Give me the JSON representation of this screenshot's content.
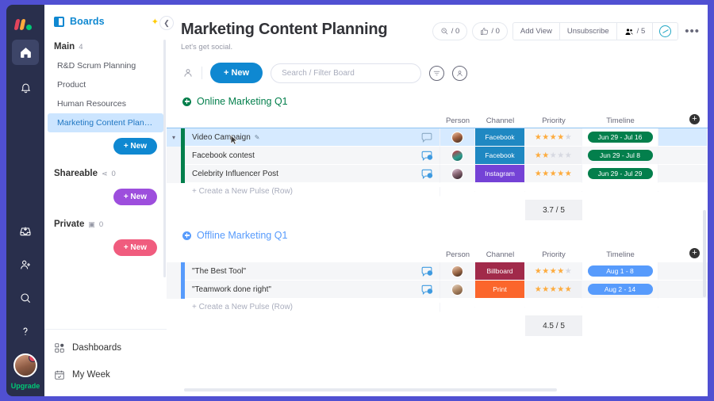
{
  "rail": {
    "logo": "monday-logo",
    "items": [
      {
        "name": "home-icon",
        "active": true
      },
      {
        "name": "notifications-bell-icon",
        "active": false
      }
    ],
    "bottom_items": [
      {
        "name": "inbox-icon"
      },
      {
        "name": "invite-member-icon"
      },
      {
        "name": "search-icon"
      },
      {
        "name": "help-icon"
      }
    ],
    "upgrade_label": "Upgrade"
  },
  "sidebar": {
    "title": "Boards",
    "favorite_icon": "star-icon",
    "collapse_icon": "chevron-left-icon",
    "sections": [
      {
        "label": "Main",
        "count": "4",
        "items": [
          {
            "label": "R&D Scrum Planning",
            "selected": false
          },
          {
            "label": "Product",
            "selected": false
          },
          {
            "label": "Human Resources",
            "selected": false
          },
          {
            "label": "Marketing Content Planning",
            "selected": true
          }
        ],
        "new_label": "+ New",
        "new_color": "#0f88d1"
      },
      {
        "label": "Shareable",
        "share_icon": "share-icon",
        "count": "0",
        "items": [],
        "new_label": "+ New",
        "new_color": "#9d4edd"
      },
      {
        "label": "Private",
        "lock_icon": "lock-icon",
        "count": "0",
        "items": [],
        "new_label": "+ New",
        "new_color": "#f05c7e"
      }
    ],
    "footer": [
      {
        "label": "Dashboards",
        "icon": "dashboard-icon"
      },
      {
        "label": "My Week",
        "icon": "calendar-icon"
      }
    ]
  },
  "board": {
    "title": "Marketing Content Planning",
    "subtitle": "Let's get social.",
    "actions": {
      "activity_count": "/ 0",
      "activity_icon": "activity-log-icon",
      "like_count": "/ 0",
      "like_icon": "thumbs-up-icon",
      "add_view": "Add View",
      "unsubscribe": "Unsubscribe",
      "members_count": "/ 5",
      "members_icon": "people-icon",
      "integrations_icon": "automations-icon",
      "more_icon": "more-options-icon"
    },
    "toolbar": {
      "avatar_icon": "person-filter-icon",
      "new_label": "+ New",
      "search_placeholder": "Search / Filter Board",
      "search_value": "",
      "filter_icon": "filter-icon",
      "person_icon": "person-icon"
    },
    "columns": [
      "Person",
      "Channel",
      "Priority",
      "Timeline"
    ],
    "add_column_icon": "add-column-icon",
    "add_row_label": "+ Create a New Pulse (Row)",
    "groups": [
      {
        "name": "Online Marketing Q1",
        "color": "#037f4c",
        "rows": [
          {
            "name": "Video Campaign",
            "selected": true,
            "edit_icon": "pencil-icon",
            "chat_icon": "chat-bubble-icon",
            "chat_badge": "",
            "person": "avatar-1",
            "channel": "Facebook",
            "channel_color": "#1f88c2",
            "priority_filled": 4,
            "priority_total": 5,
            "timeline": "Jun 29 - Jul 16",
            "timeline_color": "#037f4c"
          },
          {
            "name": "Facebook contest",
            "selected": false,
            "chat_icon": "chat-bubble-icon",
            "chat_badge": "6",
            "person": "avatar-2",
            "channel": "Facebook",
            "channel_color": "#1f88c2",
            "priority_filled": 2,
            "priority_total": 5,
            "timeline": "Jun 29 - Jul 8",
            "timeline_color": "#037f4c"
          },
          {
            "name": "Celebrity Influencer Post",
            "selected": false,
            "chat_icon": "chat-bubble-icon",
            "chat_badge": "6",
            "person": "avatar-3",
            "channel": "Instagram",
            "channel_color": "#7442d6",
            "priority_filled": 5,
            "priority_total": 5,
            "timeline": "Jun 29 - Jul 29",
            "timeline_color": "#037f4c"
          }
        ],
        "summary": "3.7 / 5"
      },
      {
        "name": "Offline Marketing Q1",
        "color": "#579bfc",
        "rows": [
          {
            "name": "\"The Best Tool\"",
            "selected": false,
            "chat_icon": "chat-bubble-icon",
            "chat_badge": "6",
            "person": "avatar-4",
            "channel": "Billboard",
            "channel_color": "#a12a4a",
            "priority_filled": 4,
            "priority_total": 5,
            "timeline": "Aug 1 - 8",
            "timeline_color": "#579bfc"
          },
          {
            "name": "\"Teamwork done right\"",
            "selected": false,
            "chat_icon": "chat-bubble-icon",
            "chat_badge": "6",
            "person": "avatar-5",
            "channel": "Print",
            "channel_color": "#fb662c",
            "priority_filled": 5,
            "priority_total": 5,
            "timeline": "Aug 2 - 14",
            "timeline_color": "#579bfc"
          }
        ],
        "summary": "4.5 / 5"
      }
    ]
  }
}
